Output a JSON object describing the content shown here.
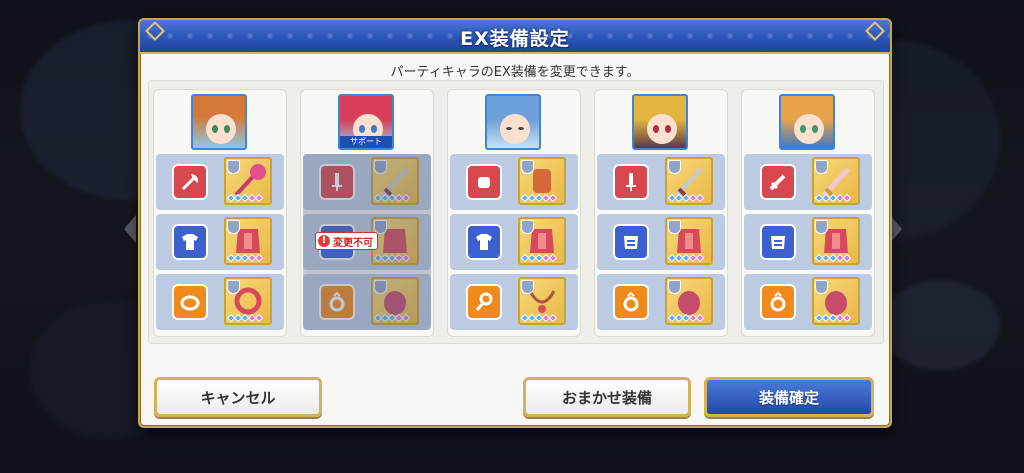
{
  "dialog": {
    "title": "EX装備設定",
    "subtitle": "パーティキャラのEX装備を変更できます。"
  },
  "characters": [
    {
      "hair_color": "#d4793a",
      "slots": [
        {
          "type_icon": "axe-icon",
          "type_color": "red",
          "equip_icon": "axe-weapon-icon"
        },
        {
          "type_icon": "shirt-icon",
          "type_color": "blue",
          "equip_icon": "red-armor-icon"
        },
        {
          "type_icon": "bracelet-icon",
          "type_color": "orange",
          "equip_icon": "red-bracelet-icon"
        }
      ]
    },
    {
      "hair_color": "#d83e57",
      "support_label": "サポート",
      "locked": true,
      "lock_text": "変更不可",
      "slots": [
        {
          "type_icon": "dagger-icon",
          "type_color": "red",
          "equip_icon": "sword-icon"
        },
        {
          "type_icon": "shield-icon",
          "type_color": "blue",
          "equip_icon": "red-armor-icon"
        },
        {
          "type_icon": "ring-icon",
          "type_color": "orange",
          "equip_icon": "red-ring-icon"
        }
      ]
    },
    {
      "hair_color": "#6d9fd8",
      "slots": [
        {
          "type_icon": "fist-icon",
          "type_color": "red",
          "equip_icon": "gauntlet-icon"
        },
        {
          "type_icon": "shirt-icon",
          "type_color": "blue",
          "equip_icon": "red-armor-icon"
        },
        {
          "type_icon": "amulet-icon",
          "type_color": "orange",
          "equip_icon": "necklace-icon"
        }
      ]
    },
    {
      "hair_color": "#e2b63f",
      "slots": [
        {
          "type_icon": "dagger-icon",
          "type_color": "red",
          "equip_icon": "sword-icon"
        },
        {
          "type_icon": "armor-icon",
          "type_color": "blue",
          "equip_icon": "red-armor-icon"
        },
        {
          "type_icon": "ring-icon",
          "type_color": "orange",
          "equip_icon": "red-ring-icon"
        }
      ]
    },
    {
      "hair_color": "#e8a24a",
      "slots": [
        {
          "type_icon": "sword-icon",
          "type_color": "red",
          "equip_icon": "crystal-sword-icon"
        },
        {
          "type_icon": "armor-icon",
          "type_color": "blue",
          "equip_icon": "red-armor-icon"
        },
        {
          "type_icon": "ring-icon",
          "type_color": "orange",
          "equip_icon": "red-ring-icon"
        }
      ]
    }
  ],
  "buttons": {
    "cancel": "キャンセル",
    "auto": "おまかせ装備",
    "confirm": "装備確定"
  },
  "colors": {
    "title_bar": "#2b55b8",
    "gold_border": "#d4b15a",
    "confirm_button": "#2349a8"
  }
}
